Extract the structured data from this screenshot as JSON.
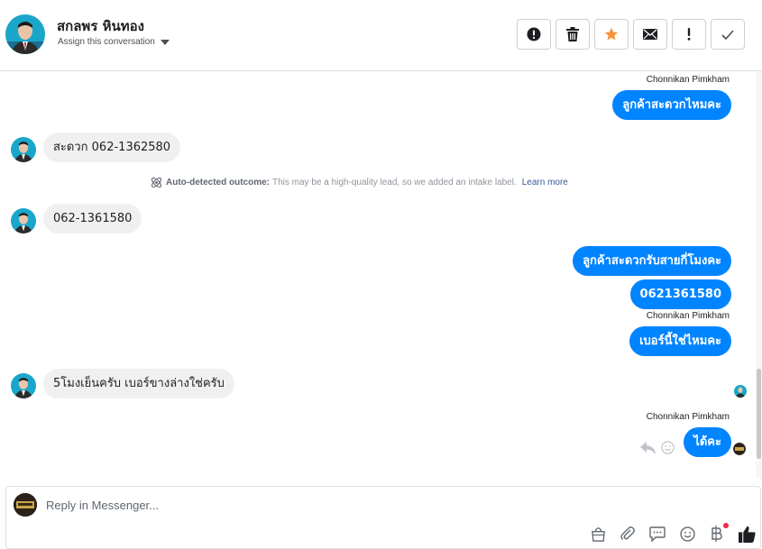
{
  "header": {
    "contact_name": "สกลพร หินทอง",
    "assign_label": "Assign this conversation",
    "actions": [
      {
        "name": "flag-button",
        "icon": "exclamation-circle-icon"
      },
      {
        "name": "delete-button",
        "icon": "trash-icon"
      },
      {
        "name": "star-button",
        "icon": "star-icon"
      },
      {
        "name": "mark-unread-button",
        "icon": "envelope-icon"
      },
      {
        "name": "important-button",
        "icon": "exclamation-icon"
      },
      {
        "name": "done-button",
        "icon": "check-icon"
      }
    ]
  },
  "messages": {
    "sender_name": "Chonnikan Pimkham",
    "m1": "ลูกค้าสะดวกไหมคะ",
    "m2": "สะดวก  062-1362580",
    "notice_title": "Auto-detected outcome:",
    "notice_text": "This may be a high-quality lead, so we added an intake label.",
    "notice_link": "Learn more",
    "m3": "062-1361580",
    "m4": "ลูกค้าสะดวกรับสายกี่โมงคะ",
    "m5": "0621361580",
    "m6": "เบอร์นี้ใช่ไหมคะ",
    "m7": "5โมงเย็นครับ   เบอร์ขางล่างใช่ครับ",
    "m8": "ได้คะ"
  },
  "composer": {
    "placeholder": "Reply in Messenger..."
  },
  "colors": {
    "accent": "#0084ff",
    "star": "#f7923b",
    "incoming_bubble": "#f0f0f0"
  }
}
